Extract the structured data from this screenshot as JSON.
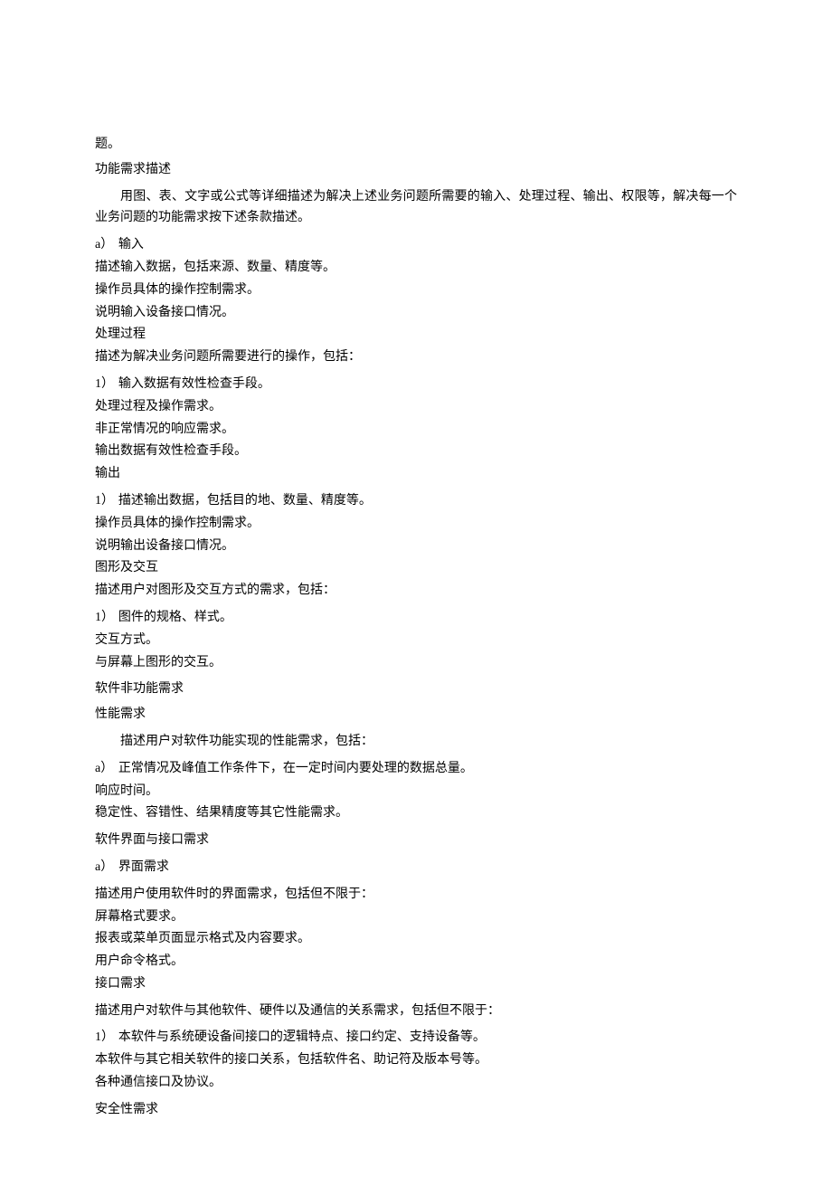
{
  "frag_top": "题。",
  "h_func_desc": "功能需求描述",
  "p_func_desc": "用图、表、文字或公式等详细描述为解决上述业务问题所需要的输入、处理过程、输出、权限等，解决每一个业务问题的功能需求按下述条款描述。",
  "a_input_marker": "a）",
  "a_input_label": "输入",
  "input_lines": {
    "l1": "描述输入数据，包括来源、数量、精度等。",
    "l2": "操作员具体的操作控制需求。",
    "l3": "说明输入设备接口情况。"
  },
  "proc_label": "处理过程",
  "proc_intro": "描述为解决业务问题所需要进行的操作，包括：",
  "proc_num_marker": "1）",
  "proc_lines": {
    "l1": "输入数据有效性检查手段。",
    "l2": "处理过程及操作需求。",
    "l3": "非正常情况的响应需求。",
    "l4": "输出数据有效性检查手段。"
  },
  "out_label": "输出",
  "out_num_marker": "1）",
  "out_lines": {
    "l1": "描述输出数据，包括目的地、数量、精度等。",
    "l2": "操作员具体的操作控制需求。",
    "l3": "说明输出设备接口情况。"
  },
  "gfx_label": "图形及交互",
  "gfx_intro": "描述用户对图形及交互方式的需求，包括：",
  "gfx_num_marker": "1）",
  "gfx_lines": {
    "l1": "图件的规格、样式。",
    "l2": "交互方式。",
    "l3": "与屏幕上图形的交互。"
  },
  "h_nonfunc": "软件非功能需求",
  "h_perf": "性能需求",
  "perf_intro": "描述用户对软件功能实现的性能需求，包括：",
  "perf_a_marker": "a）",
  "perf_lines": {
    "l1": "正常情况及峰值工作条件下，在一定时间内要处理的数据总量。",
    "l2": "响应时间。",
    "l3": "稳定性、容错性、结果精度等其它性能需求。"
  },
  "h_ui_if": "软件界面与接口需求",
  "ui_a_marker": "a）",
  "ui_label": "界面需求",
  "ui_intro": "描述用户使用软件时的界面需求，包括但不限于：",
  "ui_lines": {
    "l1": "屏幕格式要求。",
    "l2": "报表或菜单页面显示格式及内容要求。",
    "l3": "用户命令格式。"
  },
  "if_label": "接口需求",
  "if_intro": "描述用户对软件与其他软件、硬件以及通信的关系需求，包括但不限于：",
  "if_num_marker": "1）",
  "if_lines": {
    "l1": "本软件与系统硬设备间接口的逻辑特点、接口约定、支持设备等。",
    "l2": "本软件与其它相关软件的接口关系，包括软件名、助记符及版本号等。",
    "l3": "各种通信接口及协议。"
  },
  "h_security": "安全性需求"
}
